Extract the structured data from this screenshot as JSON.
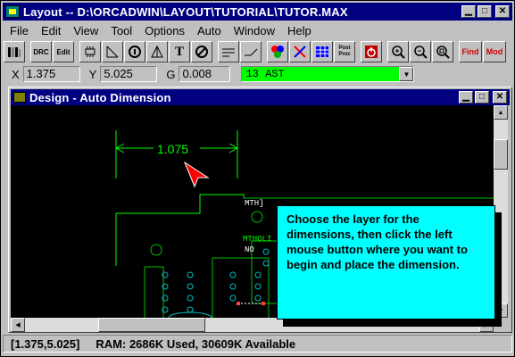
{
  "window": {
    "title": "Layout -- D:\\ORCADWIN\\LAYOUT\\TUTORIAL\\TUTOR.MAX",
    "controls": [
      "minimize-icon",
      "maximize-icon",
      "close-icon"
    ]
  },
  "menu": {
    "items": [
      "File",
      "Edit",
      "View",
      "Tool",
      "Options",
      "Auto",
      "Window",
      "Help"
    ]
  },
  "toolbar": {
    "drc_label": "DRC",
    "edit_label": "Edit",
    "text_label": "T",
    "post_label": "Post Proc",
    "find_label": "Find",
    "mod_label": "Mod"
  },
  "coords": {
    "x_label": "X",
    "x_value": "1.375",
    "y_label": "Y",
    "y_value": "5.025",
    "g_label": "G",
    "g_value": "0.008",
    "layer_value": "13 AST"
  },
  "child_window": {
    "title": "Design - Auto Dimension"
  },
  "canvas": {
    "dimension_text": "1.075",
    "labels": [
      "MTH]",
      "MTHOLI",
      "NO"
    ]
  },
  "callout": {
    "text": "Choose the layer for the dimensions, then click the left mouse button where you want to begin and place the dimension."
  },
  "status": {
    "text": "[1.375,5.025]     RAM: 2686K Used, 30609K Available"
  },
  "colors": {
    "titlebar": "#000080",
    "layer_highlight": "#00ff00",
    "callout_bg": "#00ffff",
    "canvas_bg": "#000000",
    "trace_green": "#00ff00",
    "pad_cyan": "#00c0c0"
  }
}
